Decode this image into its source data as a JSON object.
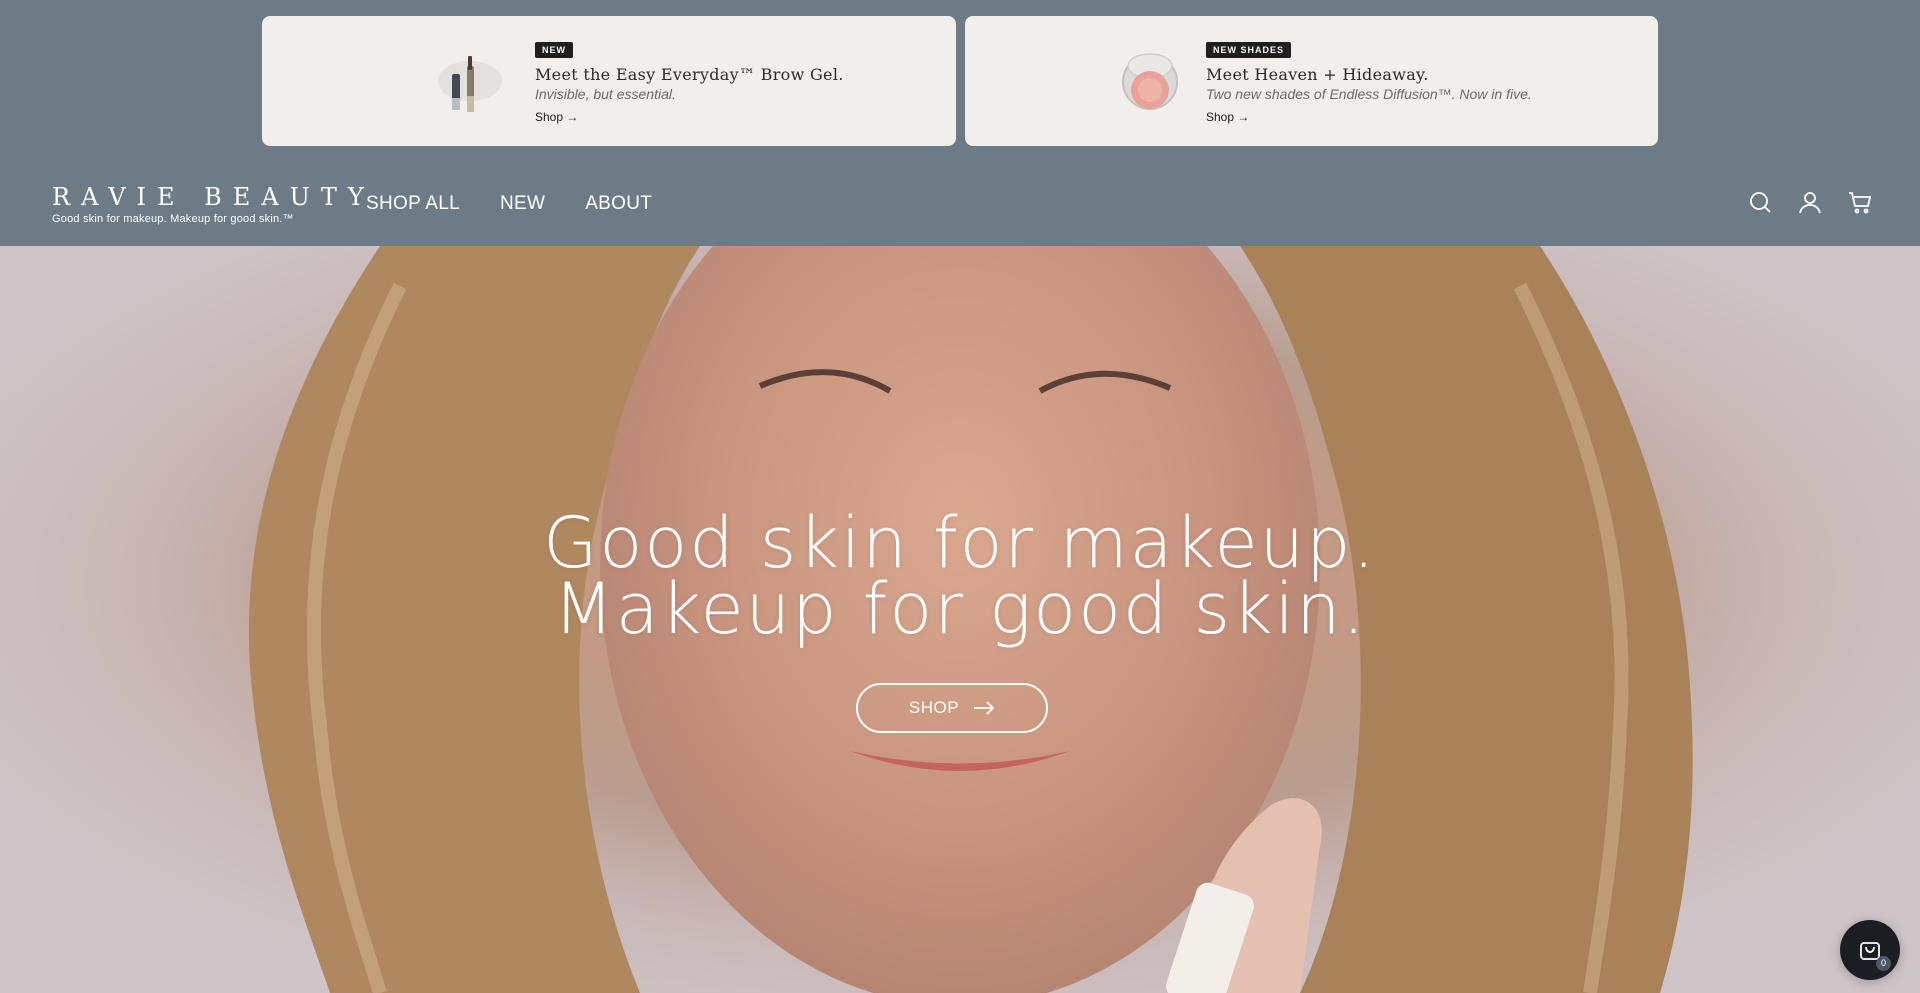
{
  "promos": [
    {
      "badge": "NEW",
      "title": "Meet the Easy Everyday™ Brow Gel.",
      "subtitle": "Invisible, but essential.",
      "link": "Shop →",
      "thumb_icon": "brow-gel-product-icon"
    },
    {
      "badge": "NEW SHADES",
      "title": "Meet Heaven + Hideaway.",
      "subtitle": "Two new shades of Endless Diffusion™. Now in five.",
      "link": "Shop →",
      "thumb_icon": "blush-compact-product-icon"
    }
  ],
  "header": {
    "logo_word": "RAVIE BEAUTY",
    "logo_tagline": "Good skin for makeup. Makeup for good skin.™",
    "nav": [
      "SHOP ALL",
      "NEW",
      "ABOUT"
    ],
    "icons": [
      "search-icon",
      "account-icon",
      "cart-icon"
    ]
  },
  "hero": {
    "headline_line1": "Good skin for makeup.",
    "headline_line2": "Makeup for good skin.",
    "button_label": "SHOP"
  },
  "floating_cart": {
    "count": "0"
  },
  "colors": {
    "header_bg": "#6d7b87",
    "promo_card_bg": "#f1eeeb",
    "badge_bg": "#1f1f1f",
    "cart_button_bg": "#1a1d21"
  }
}
